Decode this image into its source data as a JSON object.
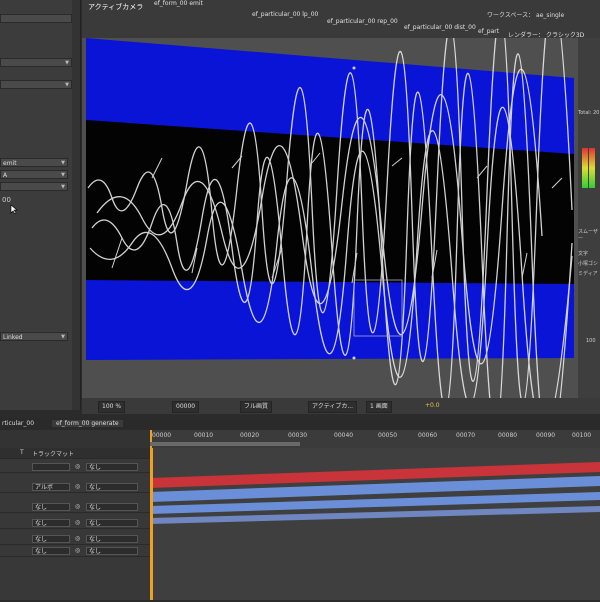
{
  "colors": {
    "bg_blue": "#0a14d6",
    "bar_red": "#c8343a",
    "bar_blue": "#6a8fd8",
    "panel": "#3c3c3c",
    "playhead": "#f0a020"
  },
  "comp_header": {
    "camera_label": "アクティブカメラ",
    "workspace_label": "ワークスペース：",
    "workspace_value": "ae_single",
    "tabs": [
      "ef_form_00 emit",
      "ef_particular_00 lp_00",
      "ef_particular_00 rep_00",
      "ef_particular_00 dist_00",
      "ef_part"
    ],
    "renderer_label": "レンダラー：",
    "renderer_value": "クラシック3D"
  },
  "left_panel": {
    "field_emit": "emit",
    "field_a": "A",
    "text_00": "00",
    "field_linked": "Linked"
  },
  "right_panel": {
    "total_label": "Total: 20",
    "smoother_label": "スムーザー",
    "char_label": "文字",
    "font_label": "小塚ゴシ",
    "style_label": "ミディア",
    "value_label": "100"
  },
  "viewer_toolbar": {
    "zoom": "100 %",
    "timecode": "00000",
    "quality": "フル画質",
    "camera": "アクティブカ...",
    "view": "1 画面",
    "exposure": "+0.0"
  },
  "timeline": {
    "tabs": [
      "rticular_00",
      "ef_form_00 generate"
    ],
    "ruler_labels": [
      "00000",
      "00010",
      "00020",
      "00030",
      "00040",
      "00050",
      "00060",
      "00070",
      "00080",
      "00090",
      "00100"
    ],
    "track_matte_header": "トラックマット",
    "t_header": "T",
    "rows": [
      {
        "mode": "",
        "parent": "なし"
      },
      {
        "mode": "アルボ",
        "parent": "なし"
      },
      {
        "mode": "なし",
        "parent": "なし"
      },
      {
        "mode": "なし",
        "parent": "なし"
      },
      {
        "mode": "なし",
        "parent": "なし"
      },
      {
        "mode": "なし",
        "parent": "なし"
      }
    ]
  }
}
